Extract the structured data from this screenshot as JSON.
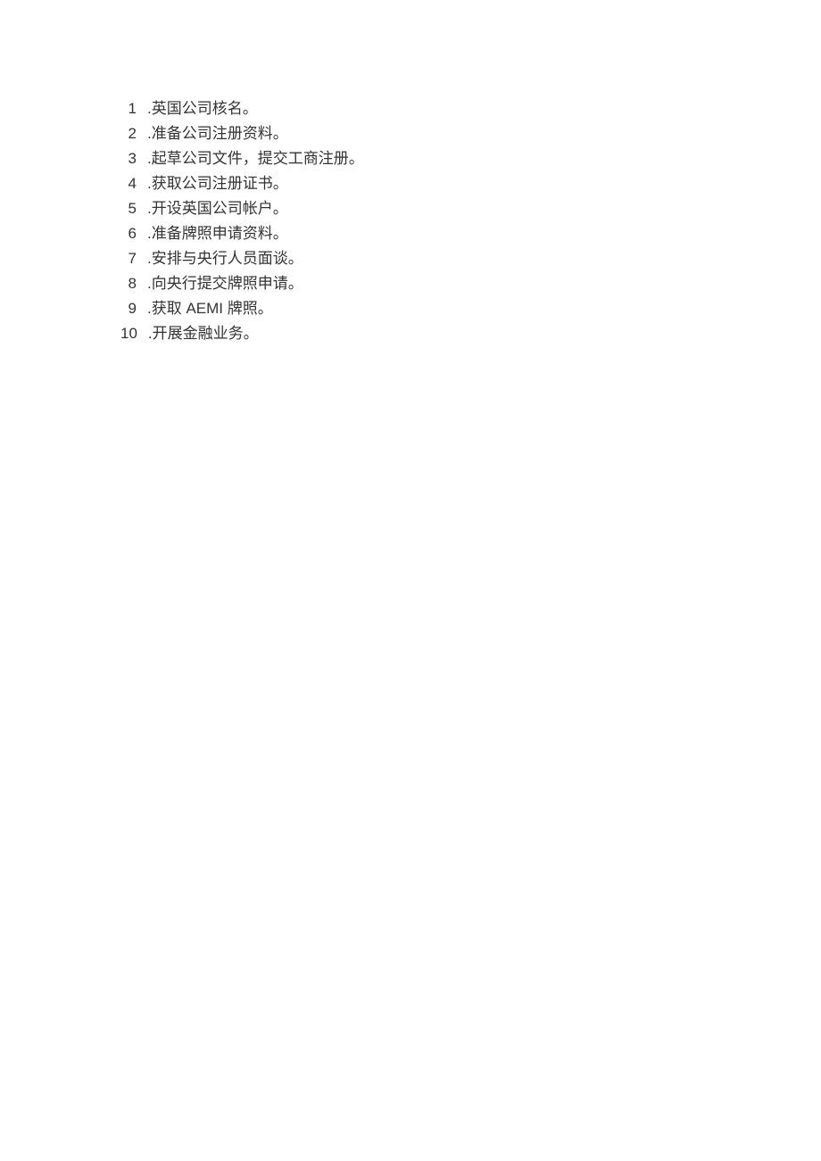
{
  "list": {
    "items": [
      {
        "number": "1",
        "text": ".英国公司核名。"
      },
      {
        "number": "2",
        "text": ".准备公司注册资料。"
      },
      {
        "number": "3",
        "text": ".起草公司文件，提交工商注册。"
      },
      {
        "number": "4",
        "text": ".获取公司注册证书。"
      },
      {
        "number": "5",
        "text": ".开设英国公司帐户。"
      },
      {
        "number": "6",
        "text": ".准备牌照申请资料。"
      },
      {
        "number": "7",
        "text": ".安排与央行人员面谈。"
      },
      {
        "number": "8",
        "text": ".向央行提交牌照申请。"
      },
      {
        "number": "9",
        "text": ".获取 AEMI 牌照。"
      },
      {
        "number": "10",
        "text": ".开展金融业务。"
      }
    ]
  }
}
